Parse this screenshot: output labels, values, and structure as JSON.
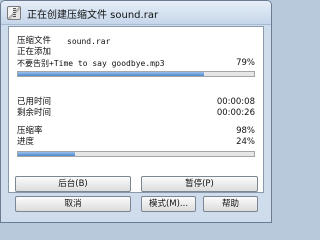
{
  "window": {
    "title": "正在创建压缩文件 sound.rar"
  },
  "archive": {
    "label": "压缩文件",
    "name": "sound.rar"
  },
  "status": {
    "adding_label": "正在添加"
  },
  "current_file": {
    "text": "不要告别+Time to say goodbye.mp3",
    "percent_text": "79%",
    "progress": 0.79
  },
  "elapsed": {
    "label": "已用时间",
    "value": "00:00:08"
  },
  "remaining": {
    "label": "剩余时间",
    "value": "00:00:26"
  },
  "ratio": {
    "label": "压缩率",
    "value": "98%"
  },
  "overall": {
    "label": "进度",
    "percent_text": "24%",
    "progress": 0.24
  },
  "buttons": {
    "background": "后台(B)",
    "pause": "暂停(P)",
    "cancel": "取消",
    "mode": "模式(M)...",
    "help": "帮助"
  },
  "colors": {
    "progress_fill": "#4d87cb",
    "window_bg": "#cfdceb"
  }
}
